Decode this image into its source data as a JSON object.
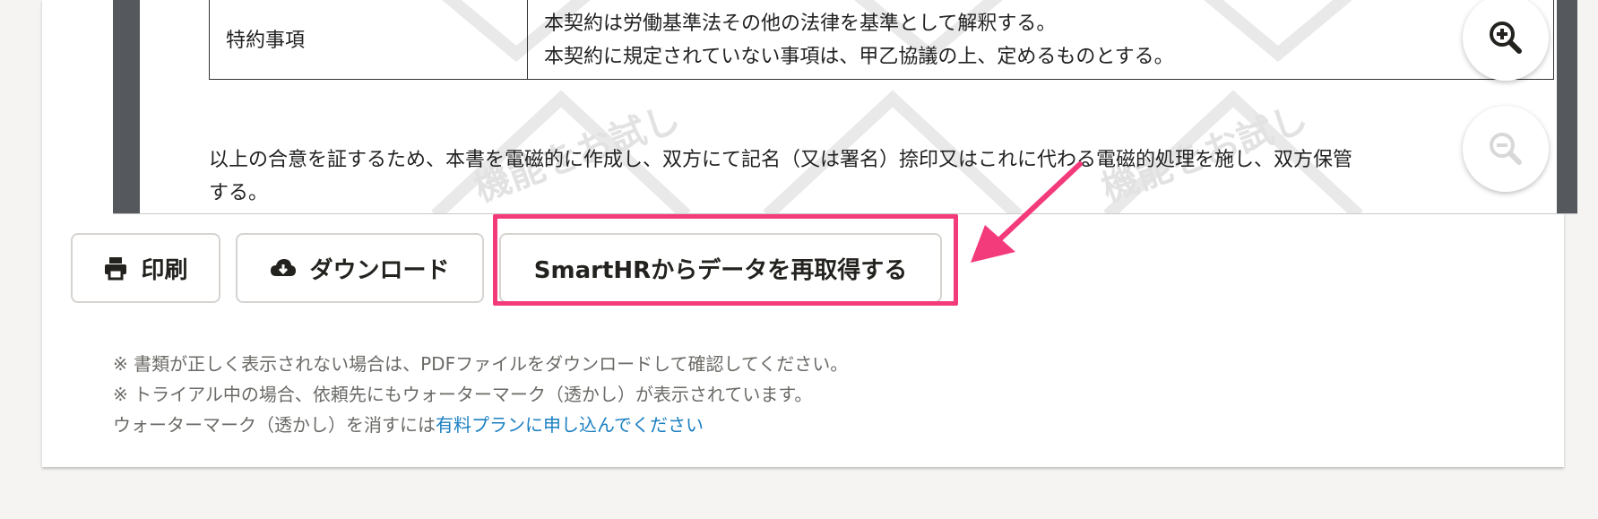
{
  "document": {
    "table_label": "特約事項",
    "table_line1": "本契約は労働基準法その他の法律を基準として解釈する。",
    "table_line2": "本契約に規定されていない事項は、甲乙協議の上、定めるものとする。",
    "closing_line1": "以上の合意を証するため、本書を電磁的に作成し、双方にて記名（又は署名）捺印又はこれに代わる電磁的処理を施し、双方保管",
    "closing_line2": "する。",
    "watermark_text": "機能をお試し"
  },
  "toolbar": {
    "print_label": "印刷",
    "download_label": "ダウンロード",
    "refetch_label": "SmartHRからデータを再取得する"
  },
  "notes": {
    "line1": "※ 書類が正しく表示されない場合は、PDFファイルをダウンロードして確認してください。",
    "line2": "※ トライアル中の場合、依頼先にもウォーターマーク（透かし）が表示されています。",
    "line3_prefix": "ウォーターマーク（透かし）を消すには",
    "line3_link": "有料プランに申し込んでください"
  },
  "colors": {
    "highlight": "#f33b7c",
    "link": "#1a7fc1",
    "viewer_bg": "#55585c"
  }
}
